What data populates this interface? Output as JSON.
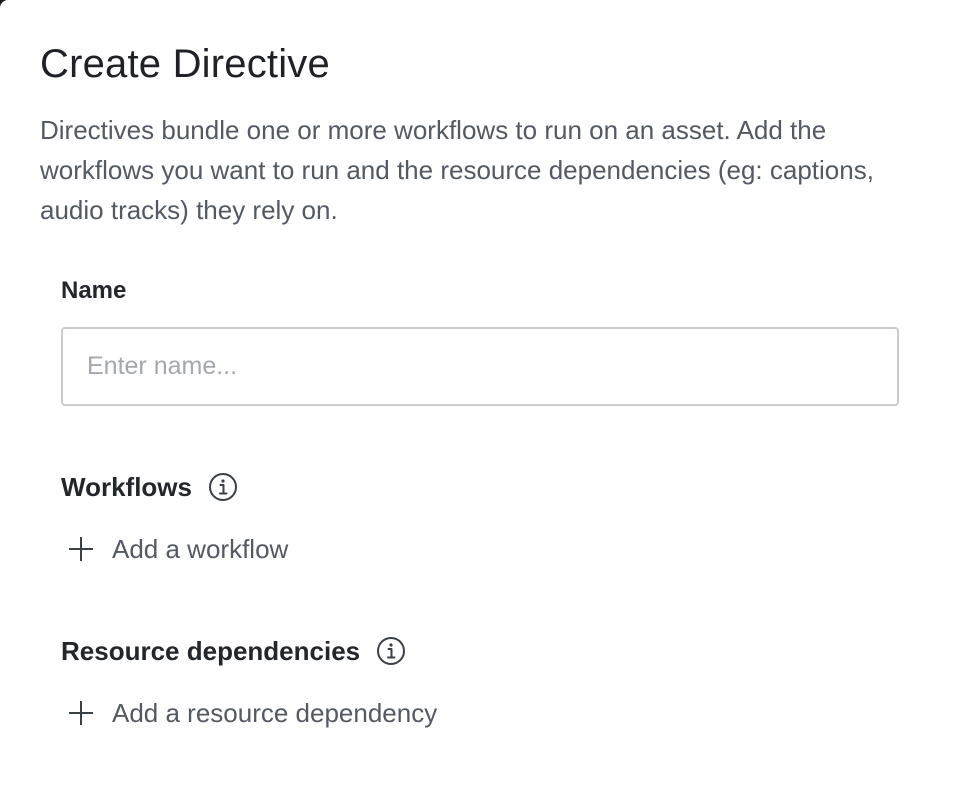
{
  "dialog": {
    "title": "Create Directive",
    "description": "Directives bundle one or more workflows to run on an asset. Add the workflows you want to run and the resource dependencies (eg: captions, audio tracks) they rely on."
  },
  "name_field": {
    "label": "Name",
    "value": "",
    "placeholder": "Enter name..."
  },
  "workflows": {
    "title": "Workflows",
    "info_icon": "info-icon",
    "add_label": "Add a workflow",
    "add_icon": "plus-icon"
  },
  "resource_dependencies": {
    "title": "Resource dependencies",
    "info_icon": "info-icon",
    "add_label": "Add a resource dependency",
    "add_icon": "plus-icon"
  }
}
